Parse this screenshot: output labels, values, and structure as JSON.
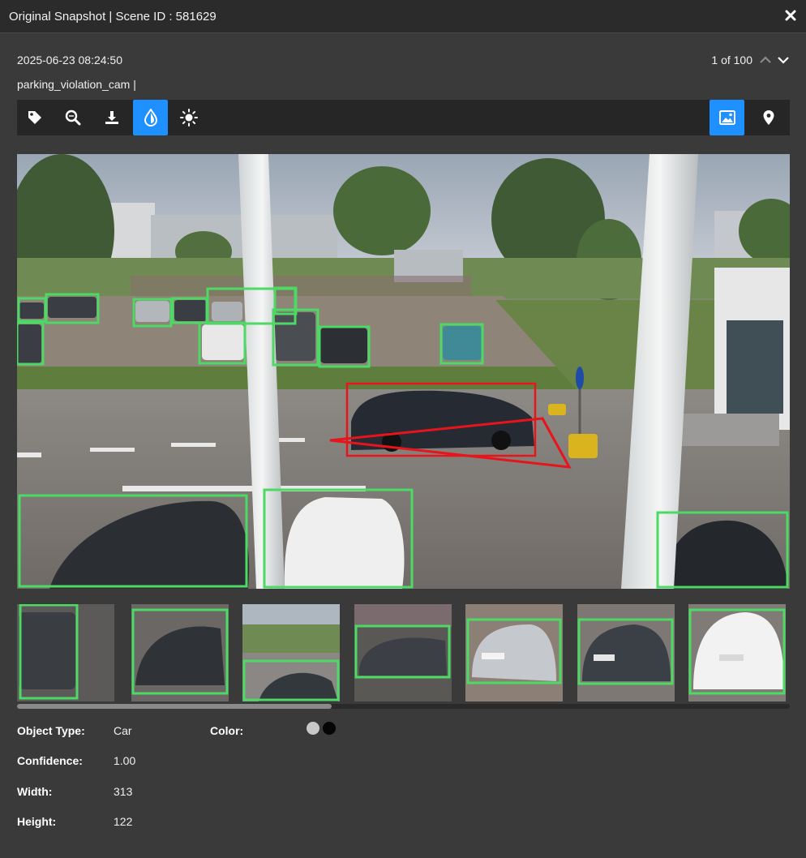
{
  "window": {
    "title": "Original Snapshot | Scene ID : 581629"
  },
  "header": {
    "timestamp": "2025-06-23 08:24:50",
    "camera": "parking_violation_cam |",
    "pager": "1 of 100"
  },
  "toolbar": {
    "left_tools": [
      "tag-icon",
      "zoom-search-icon",
      "download-icon",
      "color-drop-icon",
      "brightness-icon"
    ],
    "active_left": "color-drop-icon",
    "right_tools": [
      "image-icon",
      "location-pin-icon"
    ],
    "active_right": "image-icon",
    "accent_color": "#1e90ff"
  },
  "scene": {
    "detection_box_color": "#4cd964",
    "violation_color": "#e8141b",
    "violation_zone": "red triangle zone",
    "violating_vehicle": "dark hatchback"
  },
  "thumbnails": [
    "parked car left side",
    "dark sedan close-up",
    "dark car at bottom",
    "dark station wagon",
    "silver hatchback",
    "dark sedan rear",
    "white SUV"
  ],
  "details": {
    "object_type_label": "Object Type:",
    "object_type_value": "Car",
    "color_label": "Color:",
    "colors": [
      "#c8c8c8",
      "#050505"
    ],
    "confidence_label": "Confidence:",
    "confidence_value": "1.00",
    "width_label": "Width:",
    "width_value": "313",
    "height_label": "Height:",
    "height_value": "122"
  }
}
